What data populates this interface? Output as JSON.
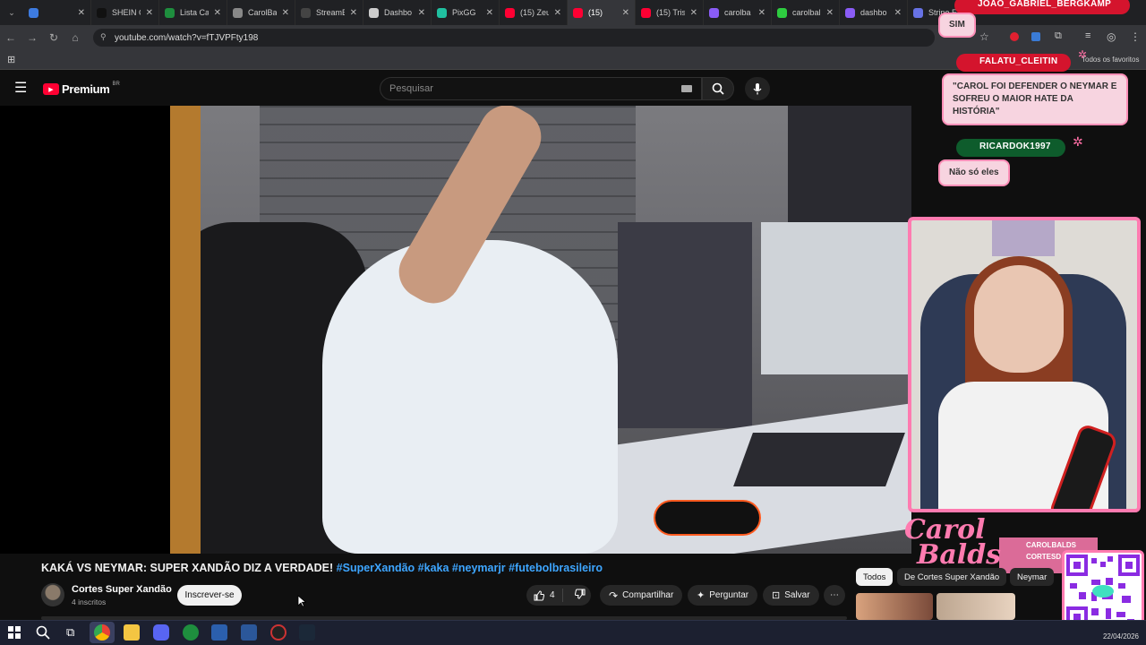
{
  "browser": {
    "tabs": [
      {
        "label": "",
        "color": "#3d7be0"
      },
      {
        "label": "SHEIN C",
        "color": "#111111"
      },
      {
        "label": "Lista Ca",
        "color": "#1e8e3e"
      },
      {
        "label": "CarolBal",
        "color": "#888888"
      },
      {
        "label": "StreamE",
        "color": "#444444"
      },
      {
        "label": "Dashbo",
        "color": "#cccccc"
      },
      {
        "label": "PixGG",
        "color": "#20c0a0"
      },
      {
        "label": "(15) Zeu",
        "color": "#ff0033"
      },
      {
        "label": "(15)",
        "color": "#ff0033",
        "active": true
      },
      {
        "label": "(15) Tris",
        "color": "#ff0033"
      },
      {
        "label": "carolba",
        "color": "#8a5cf6"
      },
      {
        "label": "carolbal",
        "color": "#2ecc40"
      },
      {
        "label": "dashbo",
        "color": "#8a5cf6"
      },
      {
        "label": "Stripe E",
        "color": "#6772e5"
      }
    ],
    "url": "youtube.com/watch?v=fTJVPFty198",
    "bookmarks_right": "Todos os favoritos"
  },
  "youtube": {
    "logo_text": "Premium",
    "logo_region": "BR",
    "search_placeholder": "Pesquisar"
  },
  "chat": {
    "messages": [
      {
        "user": "JOAO_GABRIEL_BERGKAMP",
        "text": "SIM",
        "user_color": "#d4142d"
      },
      {
        "user": "FALATU_CLEITIN",
        "text": "\"CAROL FOI DEFENDER O NEYMAR E SOFREU O MAIOR HATE DA HISTÓRIA\"",
        "user_color": "#d4142d"
      },
      {
        "user": "RICARDOK1997",
        "text": "Não só eles",
        "user_color": "#0e5c2c"
      }
    ]
  },
  "overlay": {
    "brand_line1": "Carol",
    "brand_line2": "Balds",
    "social1": "CAROLBALDS",
    "social2": "CORTESD"
  },
  "video": {
    "title_main": "KAKÁ VS NEYMAR: SUPER XANDÃO DIZ A VERDADE!",
    "title_tags": "#SuperXandão #kaka #neymarjr #futebolbrasileiro",
    "channel": "Cortes Super Xandão",
    "subscribers": "4 inscritos",
    "subscribe_label": "Inscrever-se",
    "likes": "4",
    "share_label": "Compartilhar",
    "ask_label": "Perguntar",
    "save_label": "Salvar"
  },
  "chips": [
    "Todos",
    "De Cortes Super Xandão",
    "Neymar"
  ],
  "taskbar": {
    "date": "22/04/2026"
  }
}
